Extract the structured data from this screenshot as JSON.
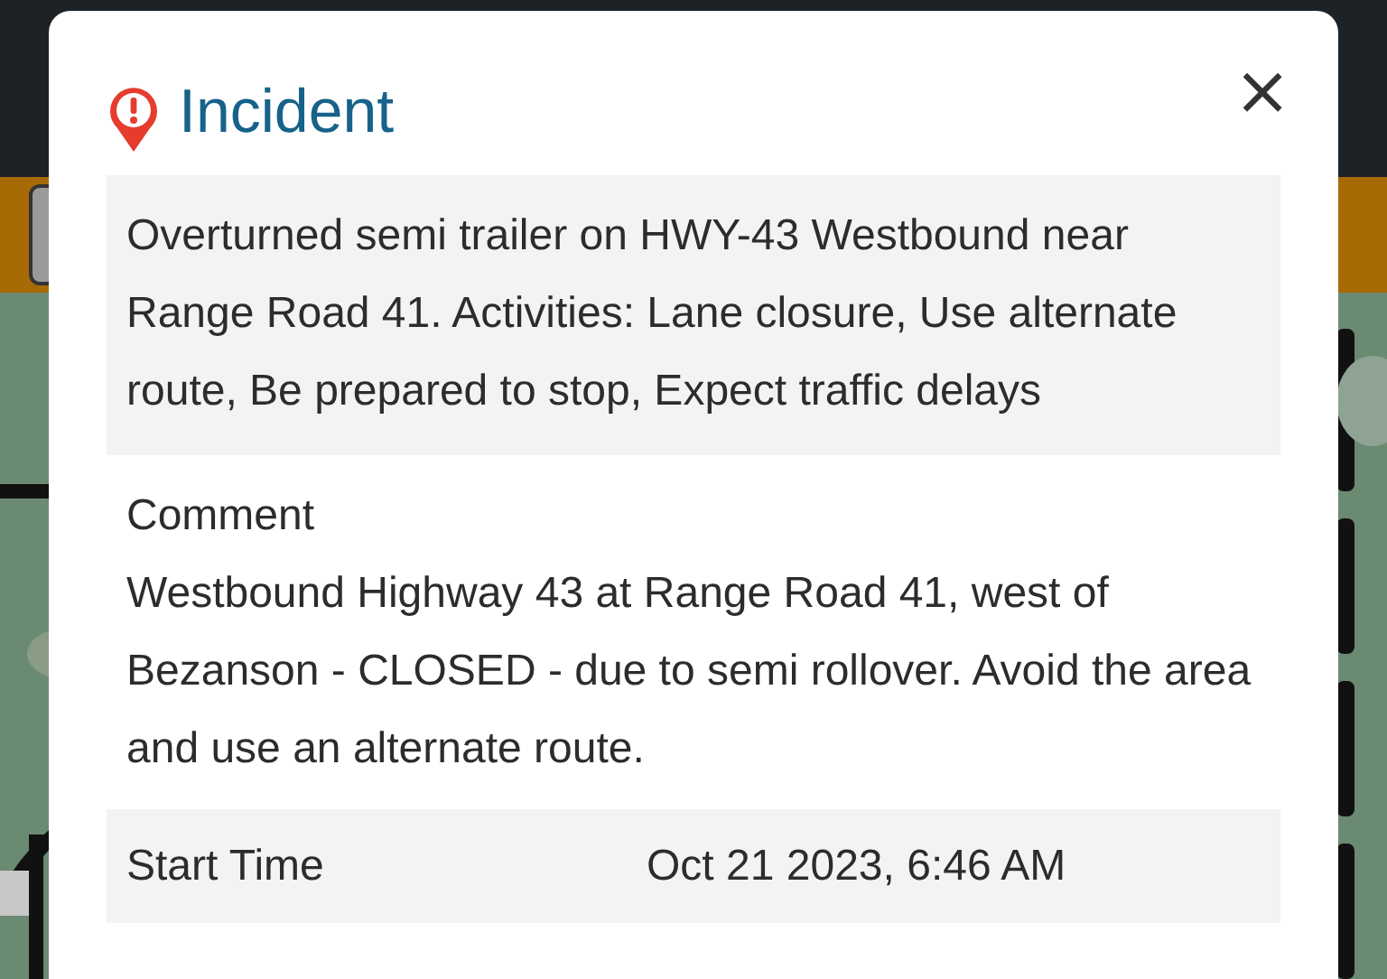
{
  "popup": {
    "title": "Incident",
    "close": "×",
    "description": "Overturned semi trailer on HWY-43 Westbound near Range Road 41. Activities: Lane closure, Use alternate route, Be prepared to stop, Expect traffic delays",
    "comment_label": "Comment",
    "comment": "Westbound Highway 43 at Range Road 41, west of Bezanson - CLOSED - due to semi rollover. Avoid the area and use an alternate route.",
    "details": [
      {
        "label": "Start Time",
        "value": "Oct 21 2023, 6:46 AM"
      }
    ]
  }
}
